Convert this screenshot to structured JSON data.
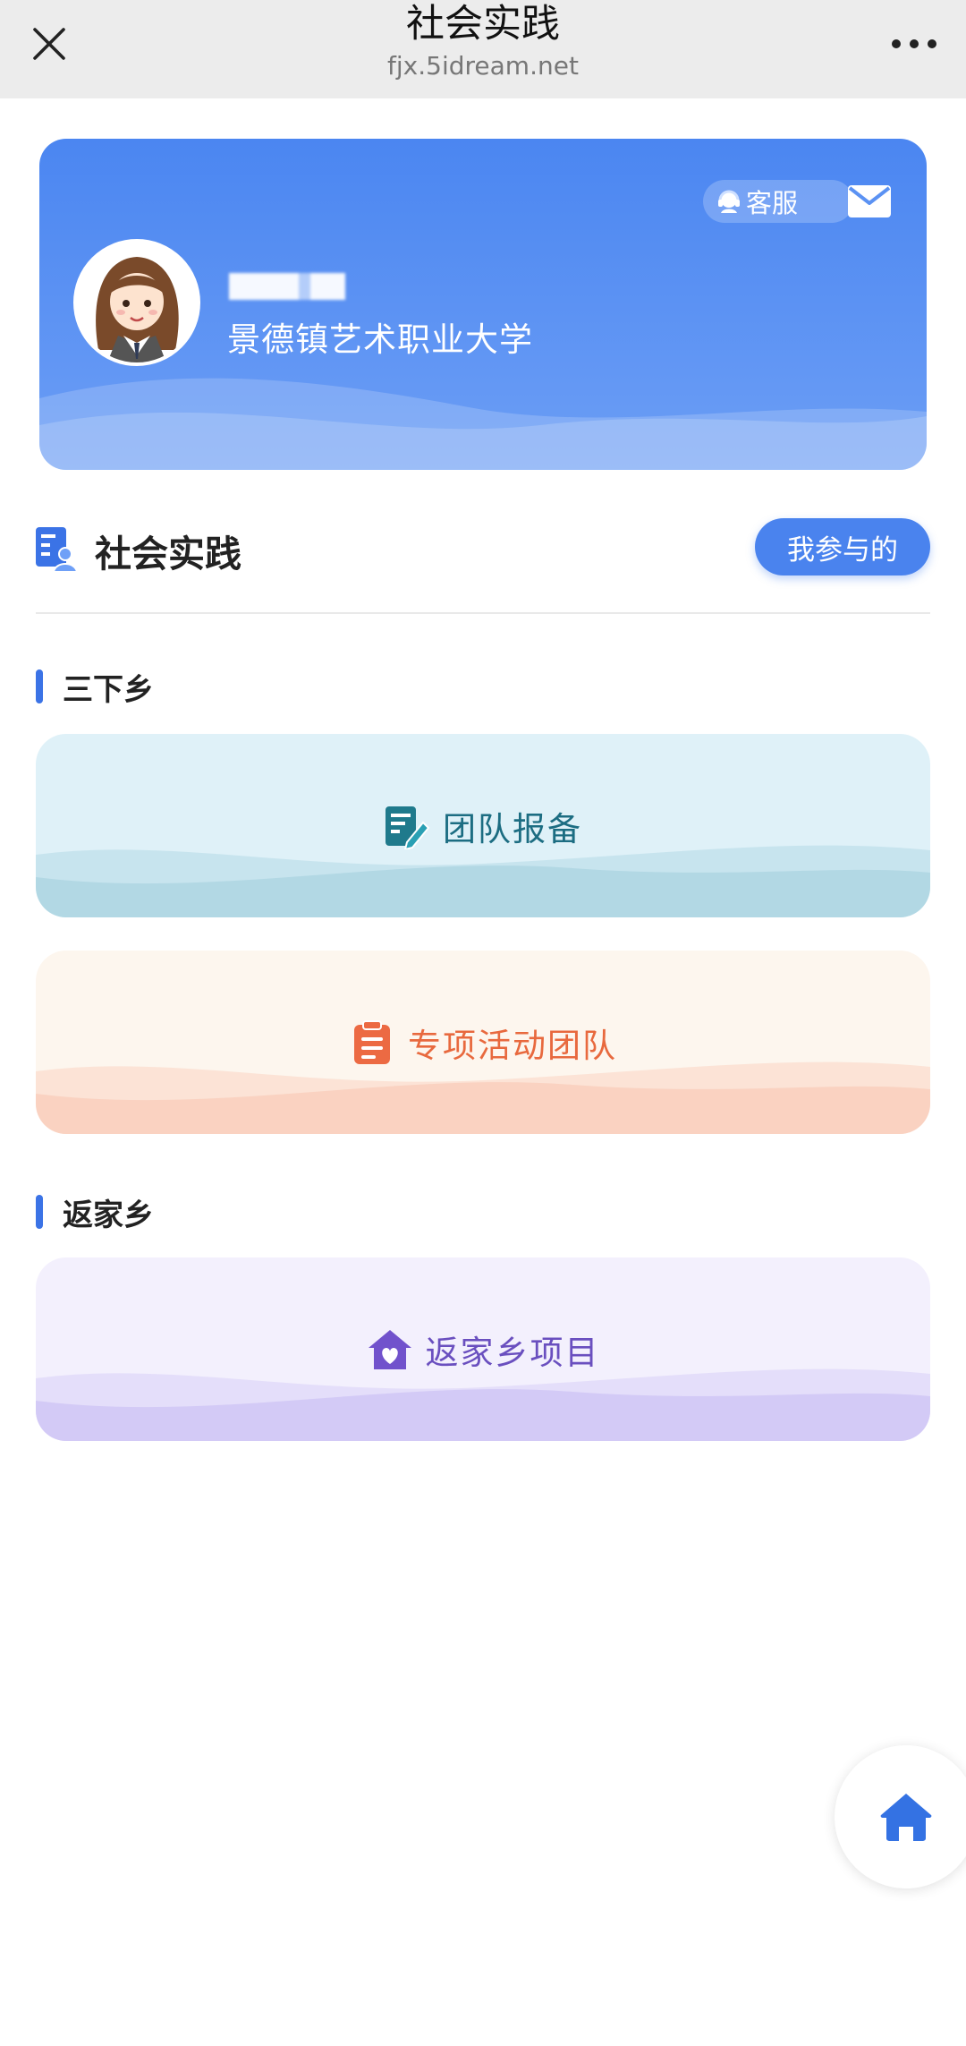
{
  "topbar": {
    "title": "社会实践",
    "url": "fjx.5idream.net"
  },
  "profile": {
    "service_label": "客服",
    "username": "",
    "school": "景德镇艺术职业大学"
  },
  "section": {
    "title": "社会实践",
    "mine_button": "我参与的"
  },
  "groups": [
    {
      "label": "三下乡",
      "cards": [
        {
          "label": "团队报备",
          "icon": "edit-document-icon"
        },
        {
          "label": "专项活动团队",
          "icon": "clipboard-icon"
        }
      ]
    },
    {
      "label": "返家乡",
      "cards": [
        {
          "label": "返家乡项目",
          "icon": "home-heart-icon"
        }
      ]
    }
  ],
  "colors": {
    "accent": "#4a83ee",
    "blue_card_text": "#1c6d82",
    "orange_card_text": "#e8693e",
    "purple_card_text": "#6a4fbf"
  }
}
